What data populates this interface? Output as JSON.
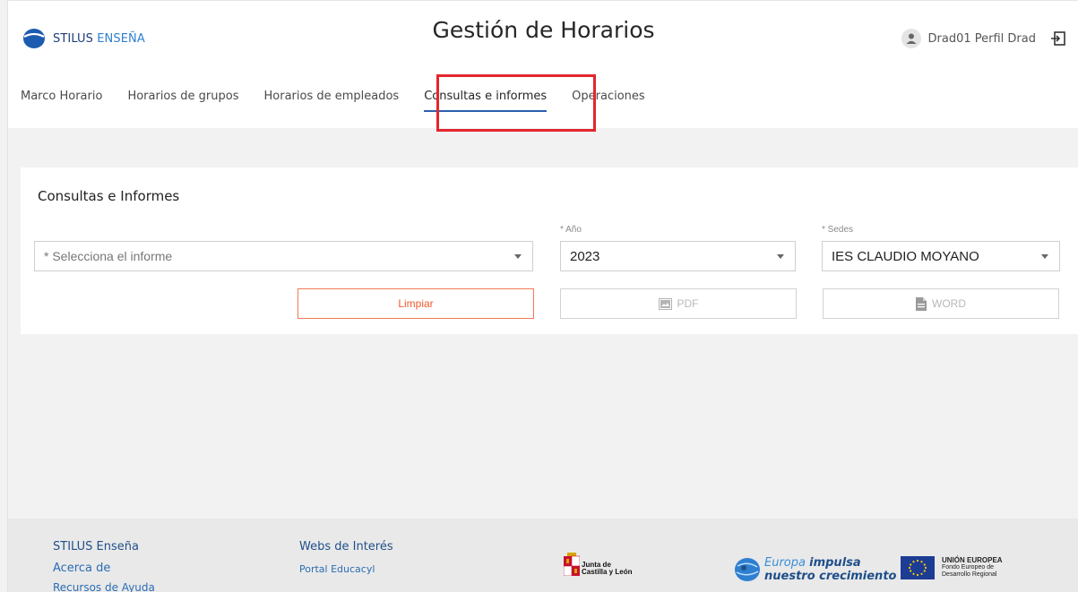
{
  "app": {
    "logo_brand": "STILUS",
    "logo_accent": "ENSEÑA",
    "page_title": "Gestión de Horarios",
    "user_name": "Drad01 Perfil Drad",
    "colors": {
      "brand": "#1f3f7a",
      "accent": "#2f80d0",
      "primary_button": "#ef5a2f",
      "highlight": "#e3262f"
    }
  },
  "tabs": [
    {
      "label": "Marco Horario",
      "active": false
    },
    {
      "label": "Horarios de grupos",
      "active": false
    },
    {
      "label": "Horarios de empleados",
      "active": false
    },
    {
      "label": "Consultas e informes",
      "active": true
    },
    {
      "label": "Operaciones",
      "active": false
    }
  ],
  "form": {
    "title": "Consultas e Informes",
    "report_select": {
      "placeholder": "* Selecciona el informe",
      "value": ""
    },
    "year": {
      "label": "* Año",
      "value": "2023"
    },
    "sedes": {
      "label": "* Sedes",
      "value": "IES CLAUDIO MOYANO"
    },
    "buttons": {
      "clear": "Limpiar",
      "pdf": "PDF",
      "word": "WORD"
    }
  },
  "footer": {
    "col1_title": "STILUS Enseña",
    "col1_links": [
      "Acerca de",
      "Recursos de Ayuda"
    ],
    "col2_title": "Webs de Interés",
    "col2_links": [
      "Portal Educacyl"
    ],
    "jcyl_logo_text": [
      "Junta de",
      "Castilla y León"
    ],
    "europa_logo_text": [
      "Europa",
      "impulsa",
      "nuestro crecimiento"
    ],
    "ue_logo_text": [
      "UNIÓN EUROPEA",
      "Fondo Europeo de",
      "Desarrollo Regional"
    ]
  },
  "icons": {
    "logo": "stilus-logo-icon",
    "user": "user-icon",
    "logout": "logout-icon",
    "caret": "chevron-down-icon",
    "pdf": "image-icon",
    "word": "document-icon"
  }
}
